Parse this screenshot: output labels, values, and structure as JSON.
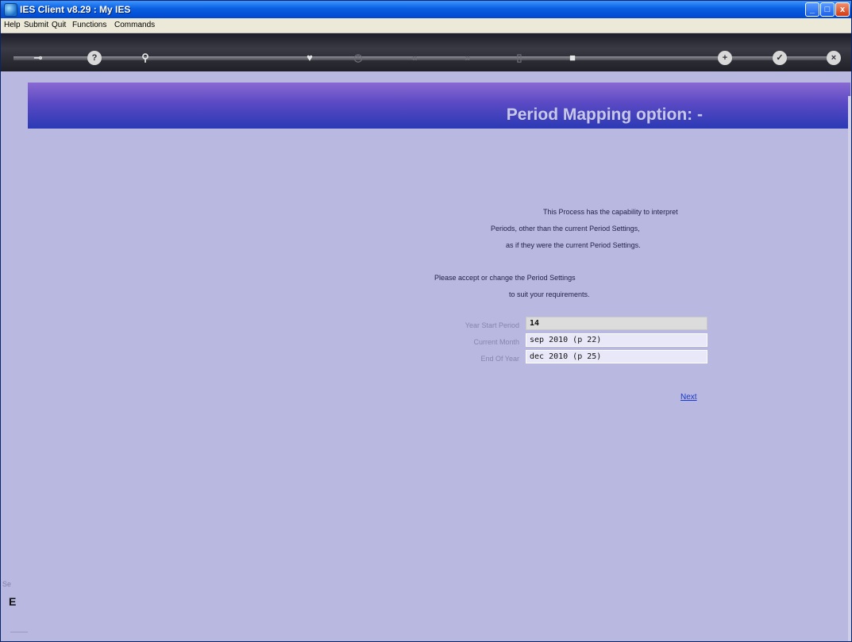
{
  "window": {
    "title": "IES Client v8.29 : My IES",
    "controls": {
      "minimize": "_",
      "maximize": "□",
      "close": "x"
    }
  },
  "menu": [
    "Help",
    "Submit",
    "Quit",
    "Functions",
    "Commands"
  ],
  "toolbar": {
    "icons": [
      "key-icon",
      "help-icon",
      "search-icon",
      "heart-icon",
      "clock-icon",
      "rewind-icon",
      "fast-forward-icon",
      "trash-icon",
      "stop-icon",
      "settings-icon",
      "check-icon",
      "close-icon"
    ]
  },
  "header": {
    "title": "Period Mapping option: -"
  },
  "info": {
    "lines": [
      "This Process has the capability to interpret",
      "Periods, other than the current Period Settings,",
      "as if they were the current Period Settings."
    ],
    "instructions": [
      "Please accept or change the Period Settings",
      "to suit your requirements."
    ]
  },
  "form": {
    "fields": [
      {
        "label": "Year Start Period",
        "value": "14"
      },
      {
        "label": "Current Month",
        "value": "sep 2010 (p 22)"
      },
      {
        "label": "End Of Year",
        "value": "dec 2010 (p 25)"
      }
    ],
    "next_label": "Next"
  },
  "footer_left": {
    "fragment": "Se",
    "letter": "E"
  }
}
